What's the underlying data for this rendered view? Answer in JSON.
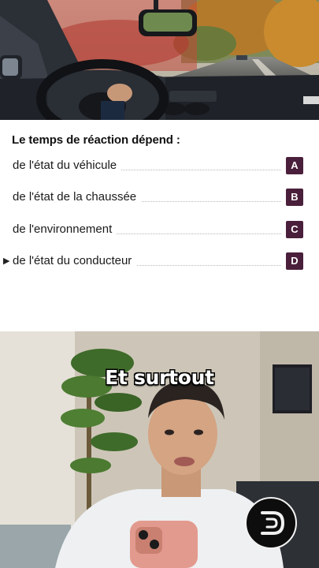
{
  "quiz": {
    "question": "Le temps de réaction dépend :",
    "answers": [
      {
        "text": "de l'état du véhicule",
        "letter": "A",
        "selected": false
      },
      {
        "text": "de l'état de la chaussée",
        "letter": "B",
        "selected": false
      },
      {
        "text": "de l'environnement",
        "letter": "C",
        "selected": false
      },
      {
        "text": "de l'état du conducteur",
        "letter": "D",
        "selected": true
      }
    ],
    "selected_marker": "▶",
    "letter_color": "#4a1f3b"
  },
  "video": {
    "caption": "Et surtout"
  },
  "icons": {
    "selected": "play-triangle-icon",
    "logo": "channel-logo-icon"
  }
}
